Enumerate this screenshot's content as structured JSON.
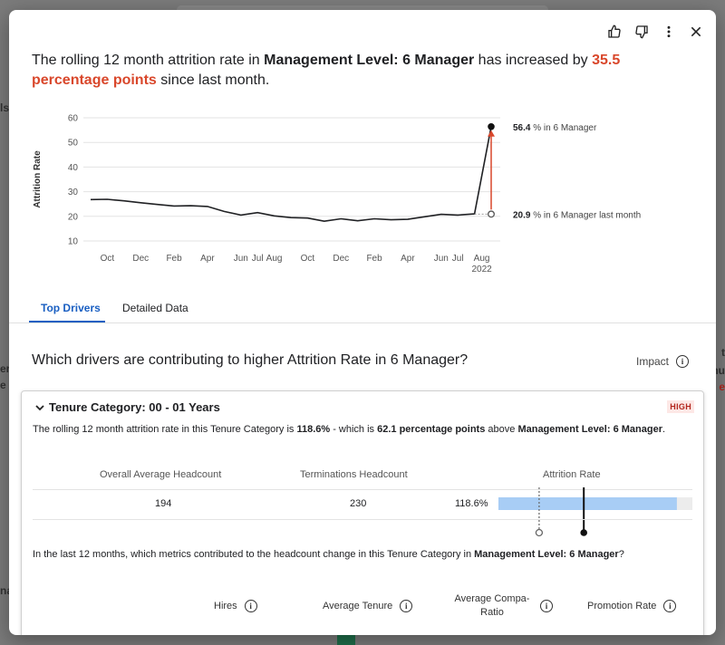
{
  "background": {
    "left_fragments": [
      "ls",
      "er",
      "e",
      "na"
    ],
    "right_fragments": [
      "t",
      "nu",
      "e"
    ]
  },
  "toolbar": {
    "thumbs_up_icon": "thumbs-up-icon",
    "thumbs_down_icon": "thumbs-down-icon",
    "more_icon": "more-vert-icon",
    "close_icon": "close-icon"
  },
  "headline": {
    "prefix": "The rolling 12 month attrition rate in ",
    "entity": "Management Level: 6 Manager",
    "middle": " has increased by ",
    "change": "35.5 percentage points",
    "suffix": " since last month."
  },
  "chart_data": {
    "type": "line",
    "ylabel": "Attrition Rate",
    "ylim": [
      10,
      60
    ],
    "yticks": [
      10,
      20,
      30,
      40,
      50,
      60
    ],
    "x_tick_labels": [
      "Oct",
      "Dec",
      "Feb",
      "Apr",
      "Jun",
      "Jul",
      "Aug",
      "Oct",
      "Dec",
      "Feb",
      "Apr",
      "Jun",
      "Jul",
      "Aug"
    ],
    "year_label": "2022",
    "grid": true,
    "series": [
      {
        "values": [
          26.8,
          26.9,
          26.3,
          25.5,
          24.8,
          24.2,
          24.3,
          24.0,
          22.0,
          20.5,
          21.5,
          20.2,
          19.5,
          19.3,
          18.0,
          19.0,
          18.2,
          19.0,
          18.6,
          18.8,
          19.8,
          20.8,
          20.5,
          21.0,
          56.4
        ]
      }
    ],
    "annotations": {
      "current": {
        "value": "56.4",
        "text": "% in 6 Manager"
      },
      "previous": {
        "value": "20.9",
        "text": "% in 6 Manager last month"
      }
    }
  },
  "tabs": [
    {
      "label": "Top Drivers",
      "active": true
    },
    {
      "label": "Detailed Data",
      "active": false
    }
  ],
  "drivers": {
    "question": "Which drivers are contributing to higher Attrition Rate in 6 Manager?",
    "impact_label": "Impact"
  },
  "card": {
    "title": "Tenure Category: 00 - 01 Years",
    "badge": "HIGH",
    "desc_prefix": "The rolling 12 month attrition rate in this Tenure Category is ",
    "desc_rate": "118.6%",
    "desc_middle": " - which is ",
    "desc_points": "62.1 percentage points",
    "desc_after": " above ",
    "desc_entity": "Management Level: 6 Manager",
    "desc_end": ".",
    "stats": {
      "headers": [
        "Overall Average Headcount",
        "Terminations Headcount",
        "Attrition Rate"
      ],
      "avg_headcount": "194",
      "terminations": "230",
      "attrition_rate": "118.6%",
      "bar_fill_fraction": 0.92,
      "benchmark_fraction": 0.21,
      "average_fraction": 0.44
    },
    "metrics_q_prefix": "In the last 12 months, which metrics contributed to the headcount change in this Tenure Category in ",
    "metrics_q_entity": "Management Level: 6 Manager",
    "metrics_q_end": "?",
    "metric_headers": [
      "Hires",
      "Average Tenure",
      "Average Compa-Ratio",
      "Promotion Rate"
    ]
  },
  "colors": {
    "accent": "#1a5fc2",
    "highlight_red": "#d9472b",
    "bar_fill": "#a8cdf5",
    "line": "#202124"
  }
}
